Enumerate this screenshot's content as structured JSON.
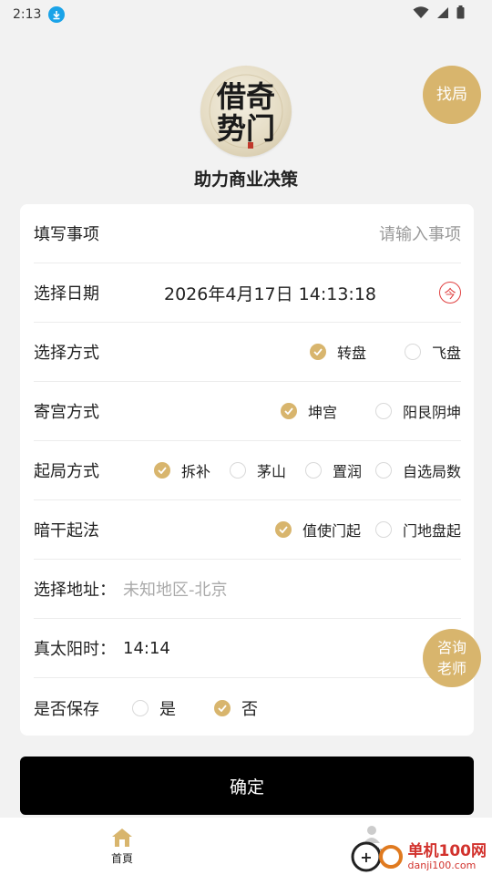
{
  "status_bar": {
    "time": "2:13",
    "icons": [
      "download-icon",
      "wifi-icon",
      "signal-icon",
      "battery-icon"
    ]
  },
  "header": {
    "logo_text": "借奇势门",
    "tagline": "助力商业决策",
    "find_button": "找局",
    "consult_button": [
      "咨询",
      "老师"
    ]
  },
  "form": {
    "item": {
      "label": "填写事项",
      "placeholder": "请输入事项"
    },
    "date": {
      "label": "选择日期",
      "value": "2026年4月17日 14:13:18",
      "now_label": "今"
    },
    "method": {
      "label": "选择方式",
      "options": [
        "转盘",
        "飞盘"
      ],
      "selected": "转盘"
    },
    "palace": {
      "label": "寄宫方式",
      "options": [
        "坤宫",
        "阳艮阴坤"
      ],
      "selected": "坤宫"
    },
    "start": {
      "label": "起局方式",
      "options": [
        "拆补",
        "茅山",
        "置润",
        "自选局数"
      ],
      "selected": "拆补"
    },
    "hidden_stem": {
      "label": "暗干起法",
      "options": [
        "值使门起",
        "门地盘起"
      ],
      "selected": "值使门起"
    },
    "address": {
      "label": "选择地址：",
      "value": "未知地区-北京"
    },
    "solar_time": {
      "label": "真太阳时：",
      "value": "14:14"
    },
    "save": {
      "label": "是否保存",
      "options": [
        "是",
        "否"
      ],
      "selected": "否"
    }
  },
  "confirm_button": "确定",
  "bottom_nav": {
    "home": "首頁",
    "second": "我的"
  },
  "watermark": {
    "name": "单机100网",
    "url": "danji100.com"
  },
  "colors": {
    "accent": "#d8b56d",
    "primary_button": "#000000",
    "now_icon": "#e04040"
  }
}
